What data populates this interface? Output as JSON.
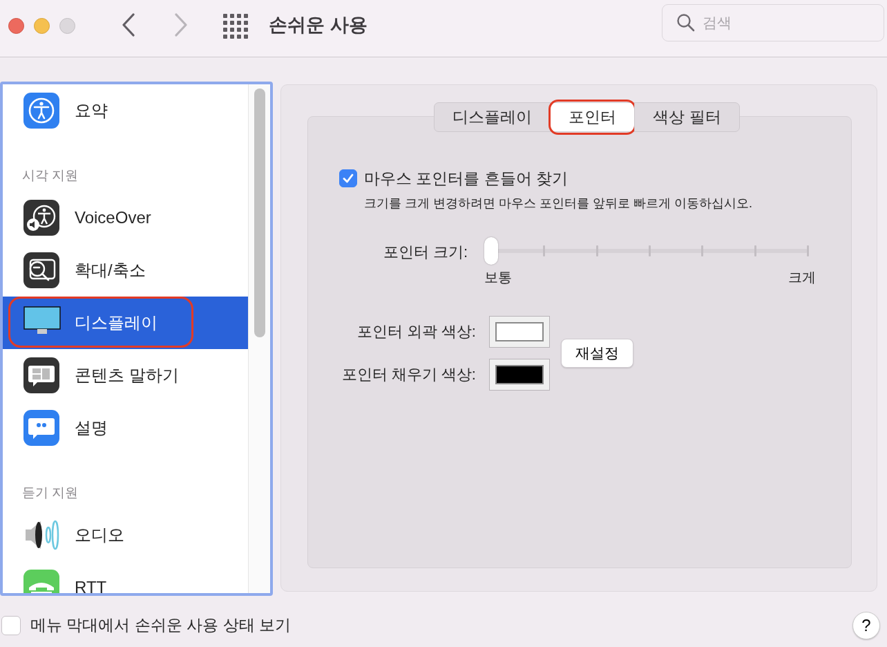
{
  "window": {
    "title": "손쉬운 사용",
    "back_disabled": false,
    "forward_disabled": true
  },
  "search": {
    "placeholder": "검색"
  },
  "sidebar": {
    "items": [
      {
        "kind": "item",
        "label": "요약",
        "selected": false,
        "highlighted": false
      },
      {
        "kind": "header",
        "label": "시각 지원"
      },
      {
        "kind": "item",
        "label": "VoiceOver",
        "selected": false,
        "highlighted": false
      },
      {
        "kind": "item",
        "label": "확대/축소",
        "selected": false,
        "highlighted": false
      },
      {
        "kind": "item",
        "label": "디스플레이",
        "selected": true,
        "highlighted": true
      },
      {
        "kind": "item",
        "label": "콘텐츠 말하기",
        "selected": false,
        "highlighted": false
      },
      {
        "kind": "item",
        "label": "설명",
        "selected": false,
        "highlighted": false
      },
      {
        "kind": "header",
        "label": "듣기 지원"
      },
      {
        "kind": "item",
        "label": "오디오",
        "selected": false,
        "highlighted": false
      },
      {
        "kind": "item",
        "label": "RTT",
        "selected": false,
        "highlighted": false
      }
    ]
  },
  "tabs": [
    {
      "label": "디스플레이",
      "selected": false,
      "highlighted": false
    },
    {
      "label": "포인터",
      "selected": true,
      "highlighted": true
    },
    {
      "label": "색상 필터",
      "selected": false,
      "highlighted": false
    }
  ],
  "shake_to_locate": {
    "label": "마우스 포인터를 흔들어 찾기",
    "checked": true,
    "description": "크기를 크게 변경하려면 마우스 포인터를 앞뒤로 빠르게 이동하십시오."
  },
  "pointer_size": {
    "label": "포인터 크기:",
    "level": 0,
    "min_label": "보통",
    "max_label": "크게"
  },
  "colors": [
    {
      "label": "포인터 외곽 색상:",
      "color": "#ffffff"
    },
    {
      "label": "포인터 채우기 색상:",
      "color": "#000000"
    }
  ],
  "reset_button": "재설정",
  "menu_bar_status": {
    "label": "메뉴 막대에서 손쉬운 사용 상태 보기",
    "checked": false
  },
  "help_button": "?"
}
